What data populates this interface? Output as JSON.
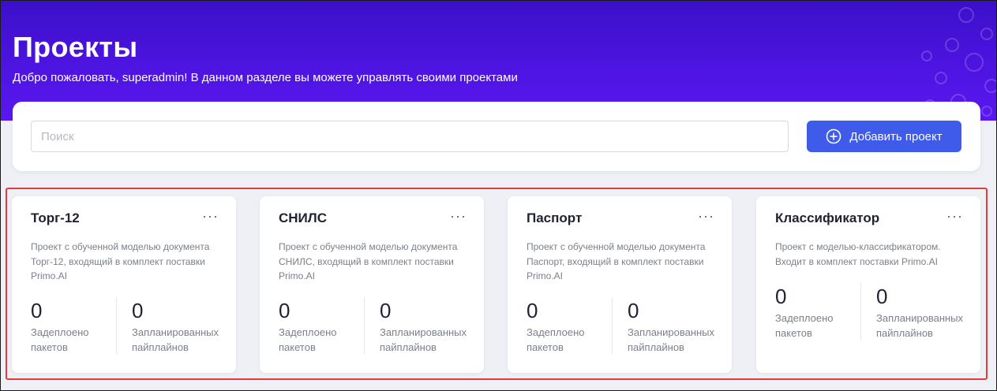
{
  "header": {
    "title": "Проекты",
    "subtitle": "Добро пожаловать, superadmin! В данном разделе вы можете управлять своими проектами"
  },
  "toolbar": {
    "search_placeholder": "Поиск",
    "add_button_label": "Добавить проект",
    "add_button_icon": "plus-circle-icon"
  },
  "colors": {
    "hero": "#4d14e0",
    "accent": "#3f5bea",
    "highlight": "#e23b3b"
  },
  "projects": [
    {
      "title": "Торг-12",
      "menu": "···",
      "description": "Проект с обученной моделью документа Торг-12, входящий в комплект поставки Primo.AI",
      "deployed_value": "0",
      "deployed_label": "Задеплоено пакетов",
      "planned_value": "0",
      "planned_label": "Запланированных пайплайнов"
    },
    {
      "title": "СНИЛС",
      "menu": "···",
      "description": "Проект с обученной моделью документа СНИЛС, входящий в комплект поставки Primo.AI",
      "deployed_value": "0",
      "deployed_label": "Задеплоено пакетов",
      "planned_value": "0",
      "planned_label": "Запланированных пайплайнов"
    },
    {
      "title": "Паспорт",
      "menu": "···",
      "description": "Проект с обученной моделью документа Паспорт, входящий в комплект поставки Primo.AI",
      "deployed_value": "0",
      "deployed_label": "Задеплоено пакетов",
      "planned_value": "0",
      "planned_label": "Запланированных пайплайнов"
    },
    {
      "title": "Классификатор",
      "menu": "···",
      "description": "Проект с моделью-классификатором. Входит в комплект поставки Primo.AI",
      "deployed_value": "0",
      "deployed_label": "Задеплоено пакетов",
      "planned_value": "0",
      "planned_label": "Запланированных пайплайнов"
    }
  ]
}
